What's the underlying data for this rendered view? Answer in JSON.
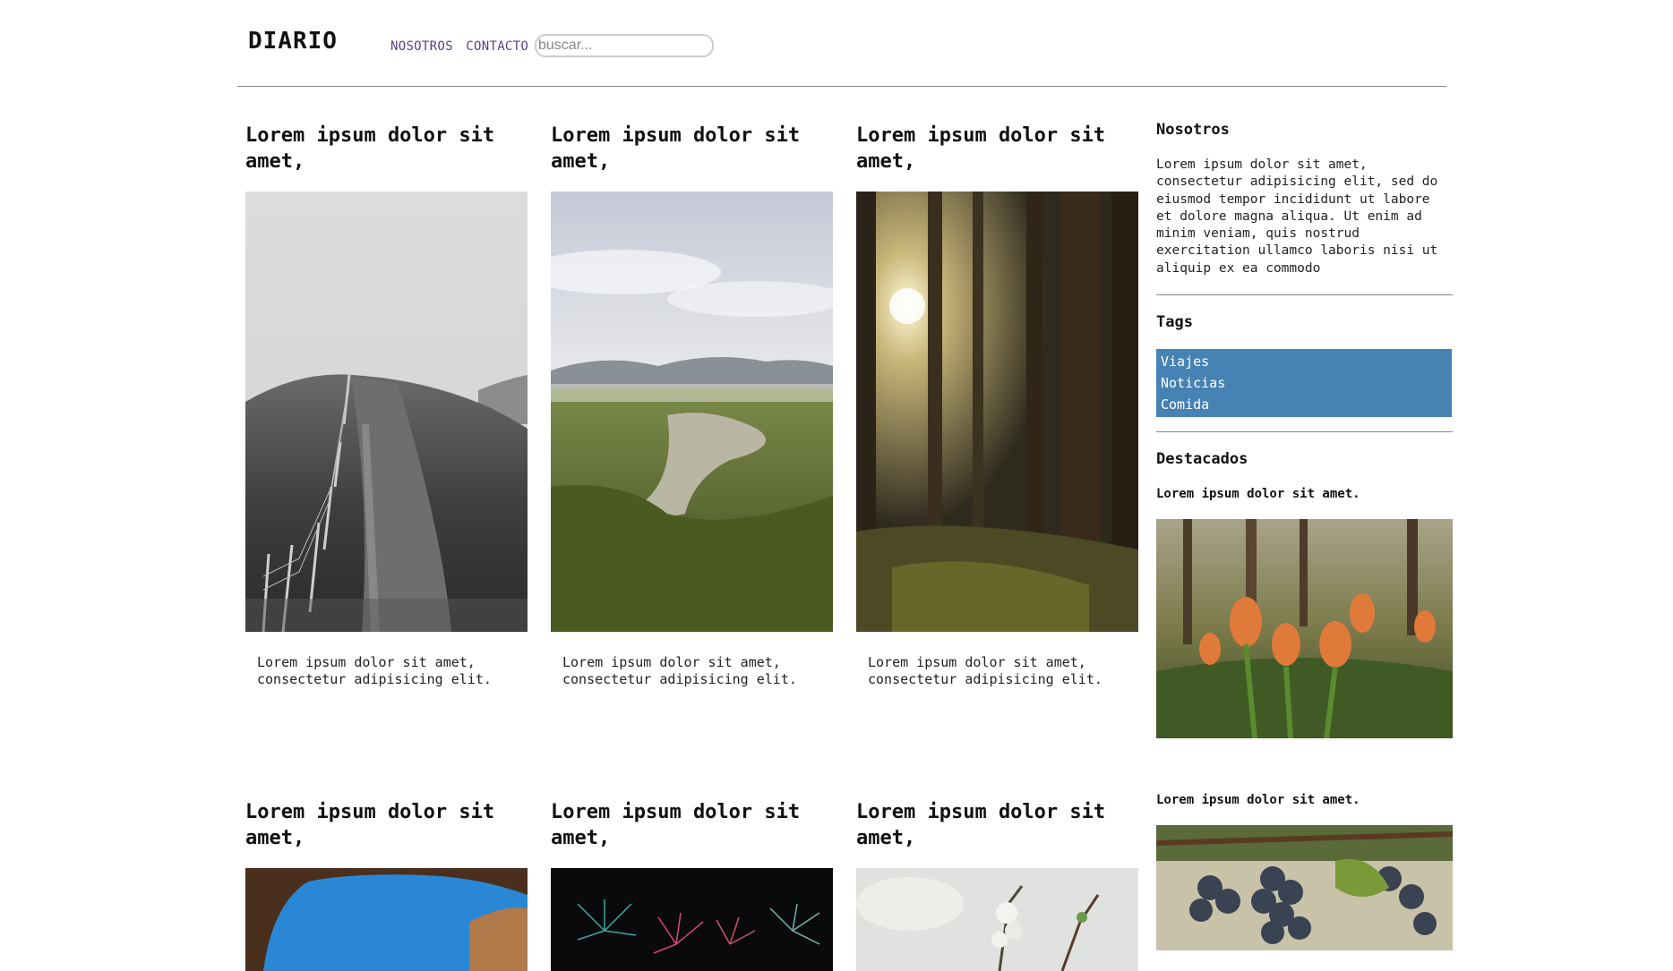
{
  "header": {
    "logo": "DIARIO",
    "nav": [
      "NOSOTROS",
      "CONTACTO"
    ],
    "search_placeholder": "buscar..."
  },
  "posts": [
    {
      "title": "Lorem ipsum dolor sit amet,",
      "excerpt": "Lorem ipsum dolor sit amet, consectetur adipisicing elit."
    },
    {
      "title": "Lorem ipsum dolor sit amet,",
      "excerpt": "Lorem ipsum dolor sit amet, consectetur adipisicing elit."
    },
    {
      "title": "Lorem ipsum dolor sit amet,",
      "excerpt": "Lorem ipsum dolor sit amet, consectetur adipisicing elit."
    },
    {
      "title": "Lorem ipsum dolor sit amet,"
    },
    {
      "title": "Lorem ipsum dolor sit amet,"
    },
    {
      "title": "Lorem ipsum dolor sit amet,"
    }
  ],
  "sidebar": {
    "about_title": "Nosotros",
    "about_text": "Lorem ipsum dolor sit amet, consectetur adipisicing elit, sed do eiusmod tempor incididunt ut labore et dolore magna aliqua. Ut enim ad minim veniam, quis nostrud exercitation ullamco laboris nisi ut aliquip ex ea commodo",
    "tags_title": "Tags",
    "tags": [
      "Viajes",
      "Noticias",
      "Comida"
    ],
    "featured_title": "Destacados",
    "featured": [
      {
        "title": "Lorem ipsum dolor sit amet."
      },
      {
        "title": "Lorem ipsum dolor sit amet."
      }
    ]
  },
  "colors": {
    "nav_link": "#5a3d8a",
    "tags_bg": "#4682b4",
    "rule": "#888888"
  }
}
